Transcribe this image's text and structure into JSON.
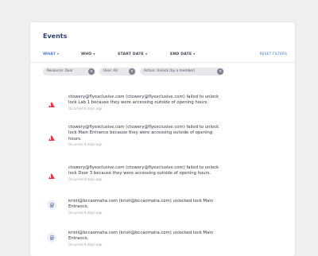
{
  "panel": {
    "title": "Events",
    "filters": [
      {
        "label": "WHAT",
        "active": true
      },
      {
        "label": "WHO",
        "active": false
      },
      {
        "label": "START DATE",
        "active": false
      },
      {
        "label": "END DATE",
        "active": false
      }
    ],
    "reset_label": "RESET FILTERS",
    "chips": [
      {
        "label": "Resource: Door"
      },
      {
        "label": "User: All"
      },
      {
        "label": "Action: Unlock (by a member)"
      }
    ]
  },
  "events": [
    {
      "type": "warning",
      "icon": "warning-icon",
      "lines": [
        "ctowery@flyexclusive.com (ctowery@flyexclusive.com) failed to unlock",
        "lock Lab 1 because they were accessing outside of opening hours."
      ],
      "time": "Occurred 8 days ago"
    },
    {
      "type": "warning",
      "icon": "warning-icon",
      "lines": [
        "ctowery@flyexclusive.com (ctowery@flyexclusive.com) failed to unlock",
        "lock Main Entrance because they were accessing outside of opening",
        "hours."
      ],
      "time": "Occurred 8 days ago"
    },
    {
      "type": "warning",
      "icon": "warning-icon",
      "lines": [
        "ctowery@flyexclusive.com (ctowery@flyexclusive.com) failed to unlock",
        "lock Door 3 because they were accessing outside of opening hours."
      ],
      "time": "Occurred 8 days ago"
    },
    {
      "type": "unlock",
      "icon": "lock-icon",
      "lines": [
        "kristi@bccaomaha.com (kristi@bccaomaha.com) unlocked lock Main",
        "Entrance."
      ],
      "time": "Occurred 8 days ago"
    },
    {
      "type": "unlock",
      "icon": "lock-icon",
      "lines": [
        "kristi@bccaomaha.com (kristi@bccaomaha.com) unlocked lock Main",
        "Entrance."
      ],
      "time": "Occurred 8 days ago"
    }
  ],
  "colors": {
    "accent": "#3f77d8",
    "warning": "#e03a47",
    "title": "#2c3e70"
  }
}
